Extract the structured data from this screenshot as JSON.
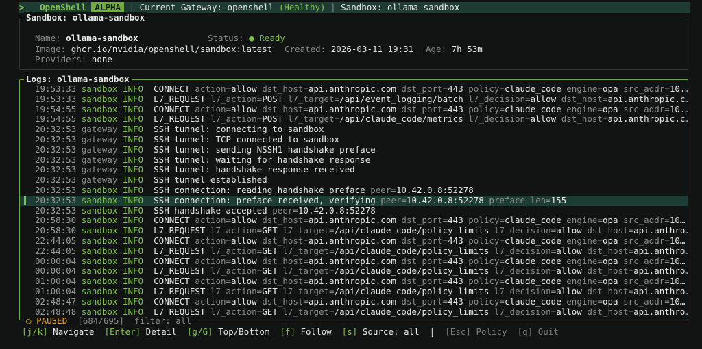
{
  "topbar": {
    "prompt": ">_",
    "brand": "OpenShell",
    "badge": "ALPHA",
    "gateway_label": "Current Gateway: openshell",
    "gateway_health": "(Healthy)",
    "sandbox_label": "Sandbox: ollama-sandbox"
  },
  "sandbox_panel": {
    "title": "Sandbox: ollama-sandbox",
    "name_label": "Name:",
    "name_value": "ollama-sandbox",
    "status_label": "Status:",
    "status_value": "Ready",
    "image_label": "Image:",
    "image_value": "ghcr.io/nvidia/openshell/sandbox:latest",
    "created_label": "Created:",
    "created_value": "2026-03-11 19:31",
    "age_label": "Age:",
    "age_value": "7h 53m",
    "providers_label": "Providers:",
    "providers_value": "none"
  },
  "logs_panel": {
    "title": "Logs: ollama-sandbox",
    "rows": [
      {
        "ts": "19:53:33",
        "src": "sandbox",
        "lvl": "INFO",
        "msg": "CONNECT",
        "fields": [
          [
            "action",
            "allow"
          ],
          [
            "dst_host",
            "api.anthropic.com"
          ],
          [
            "dst_port",
            "443"
          ],
          [
            "policy",
            "claude_code"
          ],
          [
            "engine",
            "opa"
          ],
          [
            "src_addr",
            "10.…"
          ]
        ]
      },
      {
        "ts": "19:53:33",
        "src": "sandbox",
        "lvl": "INFO",
        "msg": "L7_REQUEST",
        "fields": [
          [
            "l7_action",
            "POST"
          ],
          [
            "l7_target",
            "/api/event_logging/batch"
          ],
          [
            "l7_decision",
            "allow"
          ],
          [
            "dst_host",
            "api.anthropic.c…"
          ]
        ]
      },
      {
        "ts": "19:54:55",
        "src": "sandbox",
        "lvl": "INFO",
        "msg": "CONNECT",
        "fields": [
          [
            "action",
            "allow"
          ],
          [
            "dst_host",
            "api.anthropic.com"
          ],
          [
            "dst_port",
            "443"
          ],
          [
            "policy",
            "claude_code"
          ],
          [
            "engine",
            "opa"
          ],
          [
            "src_addr",
            "10.…"
          ]
        ]
      },
      {
        "ts": "19:54:55",
        "src": "sandbox",
        "lvl": "INFO",
        "msg": "L7_REQUEST",
        "fields": [
          [
            "l7_action",
            "POST"
          ],
          [
            "l7_target",
            "/api/claude_code/metrics"
          ],
          [
            "l7_decision",
            "allow"
          ],
          [
            "dst_host",
            "api.anthropic.c…"
          ]
        ]
      },
      {
        "ts": "20:32:53",
        "src": "gateway",
        "lvl": "INFO",
        "msg": "SSH tunnel: connecting to sandbox",
        "fields": []
      },
      {
        "ts": "20:32:53",
        "src": "gateway",
        "lvl": "INFO",
        "msg": "SSH tunnel: TCP connected to sandbox",
        "fields": []
      },
      {
        "ts": "20:32:53",
        "src": "gateway",
        "lvl": "INFO",
        "msg": "SSH tunnel: sending NSSH1 handshake preface",
        "fields": []
      },
      {
        "ts": "20:32:53",
        "src": "gateway",
        "lvl": "INFO",
        "msg": "SSH tunnel: waiting for handshake response",
        "fields": []
      },
      {
        "ts": "20:32:53",
        "src": "gateway",
        "lvl": "INFO",
        "msg": "SSH tunnel: handshake response received",
        "fields": []
      },
      {
        "ts": "20:32:53",
        "src": "gateway",
        "lvl": "INFO",
        "msg": "SSH tunnel established",
        "fields": []
      },
      {
        "ts": "20:32:53",
        "src": "sandbox",
        "lvl": "INFO",
        "msg": "SSH connection: reading handshake preface",
        "fields": [
          [
            "peer",
            "10.42.0.8:52278"
          ]
        ]
      },
      {
        "ts": "20:32:53",
        "src": "sandbox",
        "lvl": "INFO",
        "msg": "SSH connection: preface received, verifying",
        "fields": [
          [
            "peer",
            "10.42.0.8:52278"
          ],
          [
            "preface_len",
            "155"
          ]
        ],
        "selected": true
      },
      {
        "ts": "20:32:53",
        "src": "sandbox",
        "lvl": "INFO",
        "msg": "SSH handshake accepted",
        "fields": [
          [
            "peer",
            "10.42.0.8:52278"
          ]
        ]
      },
      {
        "ts": "20:58:30",
        "src": "sandbox",
        "lvl": "INFO",
        "msg": "CONNECT",
        "fields": [
          [
            "action",
            "allow"
          ],
          [
            "dst_host",
            "api.anthropic.com"
          ],
          [
            "dst_port",
            "443"
          ],
          [
            "policy",
            "claude_code"
          ],
          [
            "engine",
            "opa"
          ],
          [
            "src_addr",
            "10…"
          ]
        ]
      },
      {
        "ts": "20:58:30",
        "src": "sandbox",
        "lvl": "INFO",
        "msg": "L7_REQUEST",
        "fields": [
          [
            "l7_action",
            "GET"
          ],
          [
            "l7_target",
            "/api/claude_code/policy_limits"
          ],
          [
            "l7_decision",
            "allow"
          ],
          [
            "dst_host",
            "api.anthro…"
          ]
        ]
      },
      {
        "ts": "22:44:05",
        "src": "sandbox",
        "lvl": "INFO",
        "msg": "CONNECT",
        "fields": [
          [
            "action",
            "allow"
          ],
          [
            "dst_host",
            "api.anthropic.com"
          ],
          [
            "dst_port",
            "443"
          ],
          [
            "policy",
            "claude_code"
          ],
          [
            "engine",
            "opa"
          ],
          [
            "src_addr",
            "10…"
          ]
        ]
      },
      {
        "ts": "22:44:05",
        "src": "sandbox",
        "lvl": "INFO",
        "msg": "L7_REQUEST",
        "fields": [
          [
            "l7_action",
            "GET"
          ],
          [
            "l7_target",
            "/api/claude_code/policy_limits"
          ],
          [
            "l7_decision",
            "allow"
          ],
          [
            "dst_host",
            "api.anthro…"
          ]
        ]
      },
      {
        "ts": "00:00:04",
        "src": "sandbox",
        "lvl": "INFO",
        "msg": "CONNECT",
        "fields": [
          [
            "action",
            "allow"
          ],
          [
            "dst_host",
            "api.anthropic.com"
          ],
          [
            "dst_port",
            "443"
          ],
          [
            "policy",
            "claude_code"
          ],
          [
            "engine",
            "opa"
          ],
          [
            "src_addr",
            "10…"
          ]
        ]
      },
      {
        "ts": "00:00:04",
        "src": "sandbox",
        "lvl": "INFO",
        "msg": "L7_REQUEST",
        "fields": [
          [
            "l7_action",
            "GET"
          ],
          [
            "l7_target",
            "/api/claude_code/policy_limits"
          ],
          [
            "l7_decision",
            "allow"
          ],
          [
            "dst_host",
            "api.anthro…"
          ]
        ]
      },
      {
        "ts": "01:00:04",
        "src": "sandbox",
        "lvl": "INFO",
        "msg": "CONNECT",
        "fields": [
          [
            "action",
            "allow"
          ],
          [
            "dst_host",
            "api.anthropic.com"
          ],
          [
            "dst_port",
            "443"
          ],
          [
            "policy",
            "claude_code"
          ],
          [
            "engine",
            "opa"
          ],
          [
            "src_addr",
            "10…"
          ]
        ]
      },
      {
        "ts": "01:00:04",
        "src": "sandbox",
        "lvl": "INFO",
        "msg": "L7_REQUEST",
        "fields": [
          [
            "l7_action",
            "GET"
          ],
          [
            "l7_target",
            "/api/claude_code/policy_limits"
          ],
          [
            "l7_decision",
            "allow"
          ],
          [
            "dst_host",
            "api.anthro…"
          ]
        ]
      },
      {
        "ts": "02:48:47",
        "src": "sandbox",
        "lvl": "INFO",
        "msg": "CONNECT",
        "fields": [
          [
            "action",
            "allow"
          ],
          [
            "dst_host",
            "api.anthropic.com"
          ],
          [
            "dst_port",
            "443"
          ],
          [
            "policy",
            "claude_code"
          ],
          [
            "engine",
            "opa"
          ],
          [
            "src_addr",
            "10…"
          ]
        ]
      },
      {
        "ts": "02:48:48",
        "src": "sandbox",
        "lvl": "INFO",
        "msg": "L7_REQUEST",
        "fields": [
          [
            "l7_action",
            "GET"
          ],
          [
            "l7_target",
            "/api/claude_code/policy_limits"
          ],
          [
            "l7_decision",
            "allow"
          ],
          [
            "dst_host",
            "api.anthro…"
          ]
        ]
      }
    ]
  },
  "status": {
    "paused_icon": "○",
    "paused": "PAUSED",
    "position": "[684/695]",
    "filter": "filter: all"
  },
  "help": [
    {
      "key": "[j/k]",
      "label": "Navigate",
      "dim": false
    },
    {
      "key": "[Enter]",
      "label": "Detail",
      "dim": false
    },
    {
      "key": "[g/G]",
      "label": "Top/Bottom",
      "dim": false
    },
    {
      "key": "[f]",
      "label": "Follow",
      "dim": false
    },
    {
      "key": "[s]",
      "label": "Source: all",
      "dim": false
    },
    {
      "key": "[Esc]",
      "label": "Policy",
      "dim": true
    },
    {
      "key": "[q]",
      "label": "Quit",
      "dim": true
    }
  ],
  "colors": {
    "accent": "#7fc34a",
    "background": "#111412",
    "selected_row": "#1c3d33",
    "paused": "#e0a020"
  }
}
